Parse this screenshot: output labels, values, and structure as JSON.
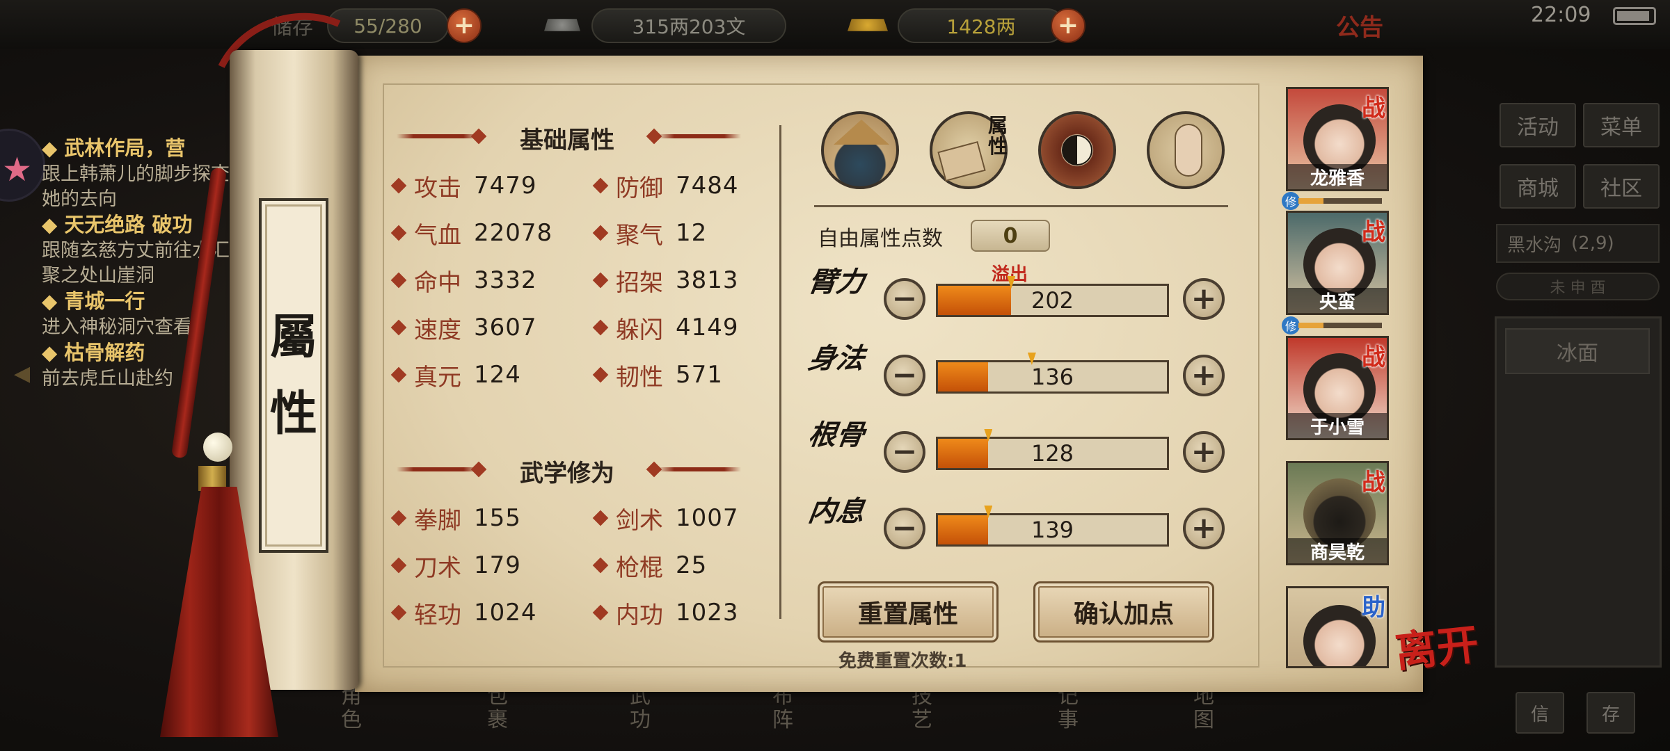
{
  "topbar": {
    "bag_label": "储存",
    "bag_value": "55/280",
    "silver": "315两203文",
    "gold": "1428两",
    "announcement": "公告",
    "time": "22:09"
  },
  "quests": [
    {
      "title": "武林作局，营",
      "desc": "跟上韩萧儿的脚步探查她的去向"
    },
    {
      "title": "天无绝路 破功",
      "desc": "跟随玄慈方丈前往水汇聚之处山崖洞"
    },
    {
      "title": "青城一行",
      "desc": "进入神秘洞穴查看"
    },
    {
      "title": "枯骨解药",
      "desc": "前去虎丘山赴约"
    }
  ],
  "right_menu": {
    "activity": "活动",
    "menu": "菜单",
    "shop": "商城",
    "community": "社区",
    "location": "黑水沟",
    "coords": "(2,9)",
    "minimap_row": "未 申 酉",
    "terrain": "冰面",
    "btn_info": "信",
    "btn_save": "存"
  },
  "scroll_label": {
    "line1": "屬",
    "line2": "性"
  },
  "basic": {
    "title": "基础属性",
    "stats": [
      {
        "name": "攻击",
        "value": "7479"
      },
      {
        "name": "防御",
        "value": "7484"
      },
      {
        "name": "气血",
        "value": "22078"
      },
      {
        "name": "聚气",
        "value": "12"
      },
      {
        "name": "命中",
        "value": "3332"
      },
      {
        "name": "招架",
        "value": "3813"
      },
      {
        "name": "速度",
        "value": "3607"
      },
      {
        "name": "躲闪",
        "value": "4149"
      },
      {
        "name": "真元",
        "value": "124"
      },
      {
        "name": "韧性",
        "value": "571"
      }
    ]
  },
  "martial": {
    "title": "武学修为",
    "stats": [
      {
        "name": "拳脚",
        "value": "155"
      },
      {
        "name": "剑术",
        "value": "1007"
      },
      {
        "name": "刀术",
        "value": "179"
      },
      {
        "name": "枪棍",
        "value": "25"
      },
      {
        "name": "轻功",
        "value": "1024"
      },
      {
        "name": "内功",
        "value": "1023"
      }
    ]
  },
  "tabs": {
    "attributes_tab": "属性"
  },
  "points": {
    "free_label": "自由属性点数",
    "free_value": "0",
    "overflow_label": "溢出",
    "attrs": [
      {
        "name": "臂力",
        "value": "202",
        "fill": 0.32,
        "marker": 0.32
      },
      {
        "name": "身法",
        "value": "136",
        "fill": 0.22,
        "marker": 0.41
      },
      {
        "name": "根骨",
        "value": "128",
        "fill": 0.22,
        "marker": 0.22
      },
      {
        "name": "内息",
        "value": "139",
        "fill": 0.22,
        "marker": 0.22
      }
    ]
  },
  "buttons": {
    "reset": "重置属性",
    "confirm": "确认加点",
    "free_reset": "免费重置次数:1"
  },
  "party": [
    {
      "name": "龙雅香",
      "tag": "战",
      "cultivation": "修"
    },
    {
      "name": "央蛮",
      "tag": "战",
      "cultivation": "修"
    },
    {
      "name": "于小雪",
      "tag": "战"
    },
    {
      "name": "商昊乾",
      "tag": "战"
    },
    {
      "name": "",
      "tag": "助"
    }
  ],
  "leave": "离开",
  "bottom_nav": [
    "角色",
    "包裹",
    "武功",
    "布阵",
    "技艺",
    "记事",
    "地图"
  ],
  "colors": {
    "accent_red": "#a03a22",
    "bar_fill": "#e6780f",
    "paper": "#e9dcc0"
  }
}
